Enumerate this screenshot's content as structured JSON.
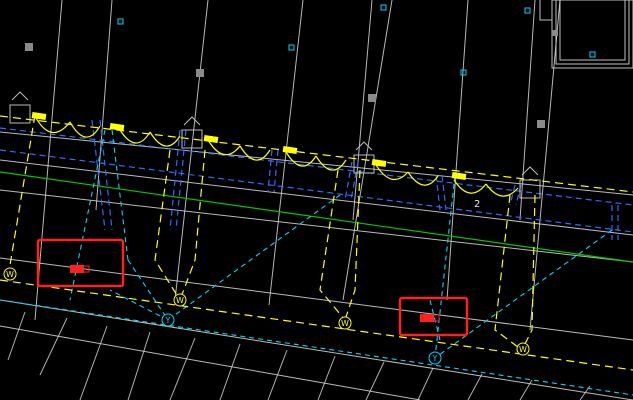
{
  "drawing": {
    "background": "#000000",
    "annotation_text": "2"
  },
  "markers": {
    "lamp_symbol": "W",
    "junction_symbol": "Y"
  },
  "colors": {
    "white_lines": "#e6e6e6",
    "gray_lines": "#bfbfbf",
    "yellow_lines": "#ffff00",
    "cyan_lines": "#00d6ff",
    "blue_dashed": "#2f6bff",
    "green_line": "#00c800",
    "highlight_red": "#ff2020"
  },
  "highlights": {
    "count": 2
  }
}
